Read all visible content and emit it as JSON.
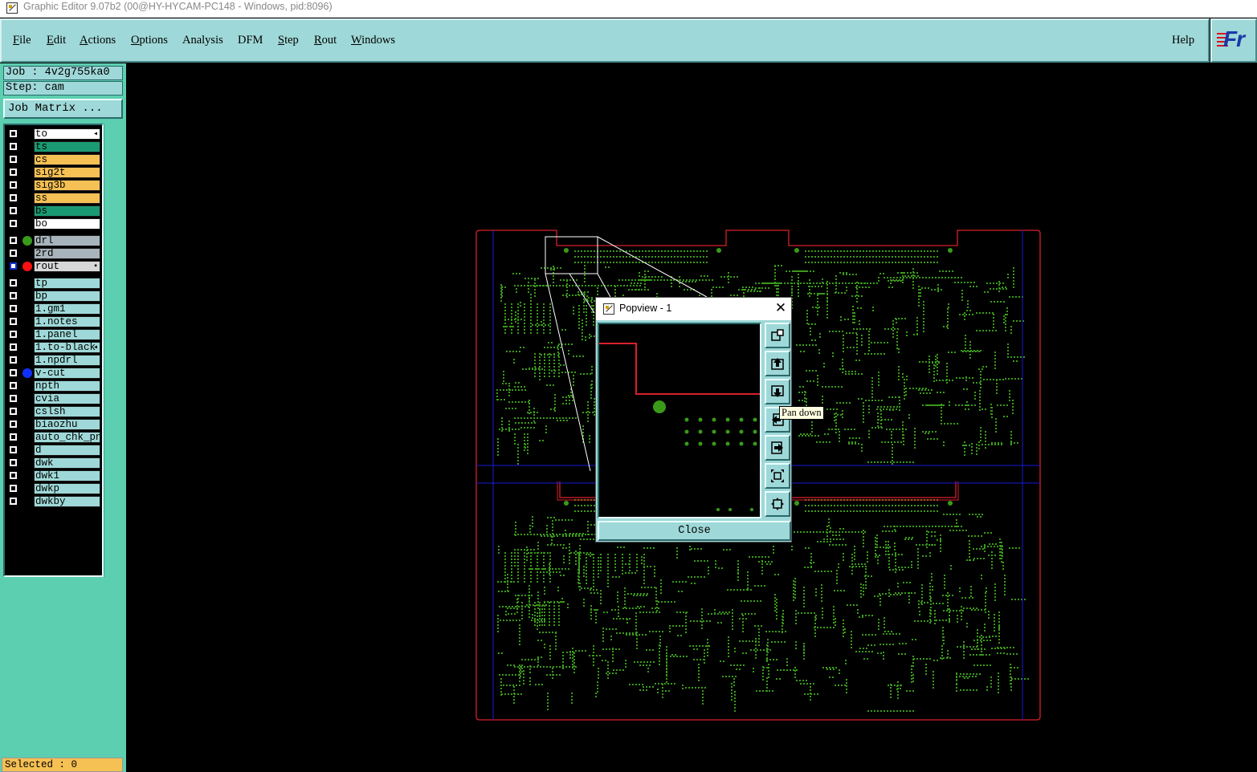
{
  "window": {
    "title": "Graphic Editor 9.07b2 (00@HY-HYCAM-PC148 - Windows, pid:8096)"
  },
  "menu": {
    "items": [
      {
        "label": "File",
        "key": "F",
        "rest": "ile"
      },
      {
        "label": "Edit",
        "key": "E",
        "rest": "dit"
      },
      {
        "label": "Actions",
        "key": "A",
        "rest": "ctions"
      },
      {
        "label": "Options",
        "key": "O",
        "rest": "ptions"
      },
      {
        "label": "Analysis",
        "key": "",
        "rest": "Analysis"
      },
      {
        "label": "DFM",
        "key": "",
        "rest": "DFM"
      },
      {
        "label": "Step",
        "key": "S",
        "rest": "tep"
      },
      {
        "label": "Rout",
        "key": "R",
        "rest": "out"
      },
      {
        "label": "Windows",
        "key": "W",
        "rest": "indows"
      }
    ],
    "help": "Help",
    "logo_text": "Fr"
  },
  "panel": {
    "job": "Job : 4v2g755ka0",
    "step": "Step: cam",
    "job_matrix": "Job Matrix ...",
    "selected": "Selected : 0"
  },
  "layers": [
    {
      "name": "to",
      "color": "#ffffff",
      "dot": "",
      "arrow": "◂"
    },
    {
      "name": "ts",
      "color": "#1a9a72",
      "dot": "",
      "arrow": ""
    },
    {
      "name": "cs",
      "color": "#f5c054",
      "dot": "",
      "arrow": ""
    },
    {
      "name": "sig2t",
      "color": "#f5c054",
      "dot": "",
      "arrow": ""
    },
    {
      "name": "sig3b",
      "color": "#f5c054",
      "dot": "",
      "arrow": ""
    },
    {
      "name": "ss",
      "color": "#f5c054",
      "dot": "",
      "arrow": ""
    },
    {
      "name": "bs",
      "color": "#1a9a72",
      "dot": "",
      "arrow": ""
    },
    {
      "name": "bo",
      "color": "#ffffff",
      "dot": "",
      "arrow": ""
    },
    {
      "name": "drl",
      "color": "#a8b4bc",
      "dot": "#3a9a1a",
      "arrow": ""
    },
    {
      "name": "2rd",
      "color": "#a8b4bc",
      "dot": "",
      "arrow": ""
    },
    {
      "name": "rout",
      "color": "#d8d8d8",
      "dot": "#ff1010",
      "arrow": "▪",
      "active": true
    },
    {
      "name": "tp",
      "color": "#9fd8d8",
      "dot": "",
      "arrow": ""
    },
    {
      "name": "bp",
      "color": "#9fd8d8",
      "dot": "",
      "arrow": ""
    },
    {
      "name": "1.gm1",
      "color": "#9fd8d8",
      "dot": "",
      "arrow": ""
    },
    {
      "name": "1.notes",
      "color": "#9fd8d8",
      "dot": "",
      "arrow": ""
    },
    {
      "name": "1.panel",
      "color": "#9fd8d8",
      "dot": "",
      "arrow": ""
    },
    {
      "name": "1.to-black",
      "color": "#9fd8d8",
      "dot": "",
      "arrow": "◂"
    },
    {
      "name": "1.npdrl",
      "color": "#9fd8d8",
      "dot": "",
      "arrow": ""
    },
    {
      "name": "v-cut",
      "color": "#9fd8d8",
      "dot": "#1030ff",
      "arrow": ""
    },
    {
      "name": "npth",
      "color": "#9fd8d8",
      "dot": "",
      "arrow": ""
    },
    {
      "name": "cvia",
      "color": "#9fd8d8",
      "dot": "",
      "arrow": ""
    },
    {
      "name": "cslsh",
      "color": "#9fd8d8",
      "dot": "",
      "arrow": ""
    },
    {
      "name": "biaozhu",
      "color": "#9fd8d8",
      "dot": "",
      "arrow": ""
    },
    {
      "name": "auto_chk_pnl",
      "color": "#9fd8d8",
      "dot": "",
      "arrow": ""
    },
    {
      "name": "d",
      "color": "#9fd8d8",
      "dot": "",
      "arrow": ""
    },
    {
      "name": "dwk",
      "color": "#9fd8d8",
      "dot": "",
      "arrow": ""
    },
    {
      "name": "dwk1",
      "color": "#9fd8d8",
      "dot": "",
      "arrow": ""
    },
    {
      "name": "dwkp",
      "color": "#9fd8d8",
      "dot": "",
      "arrow": ""
    },
    {
      "name": "dwkby",
      "color": "#9fd8d8",
      "dot": "",
      "arrow": ""
    }
  ],
  "popview": {
    "title": "Popview - 1",
    "close_label": "Close",
    "tools": [
      "zoom-window-icon",
      "pan-up-icon",
      "pan-down-icon",
      "pan-left-icon",
      "pan-right-icon",
      "zoom-fit-icon",
      "zoom-out-icon"
    ]
  },
  "tooltip": "Pan down",
  "colors": {
    "panel_teal": "#5ccfb0",
    "menu_cyan": "#9fd8d8",
    "rout_red": "#d8202a",
    "vcut_blue": "#1a1ad8",
    "pad_green": "#3a9a1a"
  }
}
